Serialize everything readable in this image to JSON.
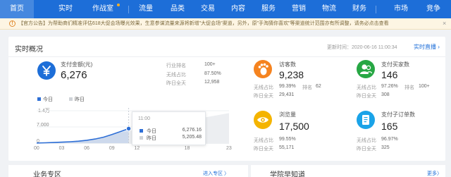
{
  "nav": {
    "items": [
      "首页",
      "实时",
      "作战室",
      "流量",
      "品类",
      "交易",
      "内容",
      "服务",
      "营销",
      "物流",
      "财务",
      "市场",
      "竞争"
    ],
    "active_index": 0,
    "badge_item": "作战室"
  },
  "notice": {
    "icon": "warning-icon",
    "text": "【官方公告】为帮助商们精准评估618大促会场曝光效果，生意参谋流量来源将新增\"大促会场\"渠道，另外，原\"手淘猜你喜欢\"等渠道统计范围亦有所调整，请务必点击查看",
    "close": "×"
  },
  "realtime": {
    "title": "实时概况",
    "update_time": "更新时间：2020-06-16 11:00:34",
    "monitor_link": "实时直播 ›",
    "pay": {
      "icon": "yuan-icon",
      "label": "支付金额(元)",
      "value": "6,276",
      "stats": [
        {
          "key": "行业排名",
          "value": "100+"
        },
        {
          "key": "无线占比",
          "value": "87.50%"
        },
        {
          "key": "昨日全天",
          "value": "12,958"
        }
      ]
    },
    "metrics": [
      {
        "icon": "footprint-icon",
        "color": "#f5831f",
        "label": "访客数",
        "value": "9,238",
        "stats": [
          {
            "key": "无线占比",
            "value": "99.39%"
          },
          {
            "key": "排名",
            "value": "62"
          },
          {
            "key": "昨日全天",
            "value": "29,431"
          }
        ]
      },
      {
        "icon": "buyer-icon",
        "color": "#27a744",
        "label": "支付买家数",
        "value": "146",
        "stats": [
          {
            "key": "无线占比",
            "value": "97.26%"
          },
          {
            "key": "排名",
            "value": "100+"
          },
          {
            "key": "昨日全天",
            "value": "308"
          }
        ]
      },
      {
        "icon": "eye-icon",
        "color": "#f4b400",
        "label": "浏览量",
        "value": "17,500",
        "stats": [
          {
            "key": "无线占比",
            "value": "99.55%"
          },
          {
            "key": "昨日全天",
            "value": "55,171"
          }
        ]
      },
      {
        "icon": "order-icon",
        "color": "#1aa3e8",
        "label": "支付子订单数",
        "value": "165",
        "stats": [
          {
            "key": "无线占比",
            "value": "96.97%"
          },
          {
            "key": "昨日全天",
            "value": "325"
          }
        ]
      }
    ]
  },
  "chart_data": {
    "type": "area",
    "x": [
      "00",
      "01",
      "02",
      "03",
      "04",
      "05",
      "06",
      "07",
      "08",
      "09",
      "10",
      "11"
    ],
    "x_ticks": [
      "00",
      "03",
      "06",
      "09",
      "12",
      "18",
      "23"
    ],
    "y_ticks": [
      "1.4万",
      "7,000",
      "0"
    ],
    "ylim": [
      0,
      14000
    ],
    "series": [
      {
        "name": "今日",
        "color": "#2e6fd6",
        "values": [
          60,
          150,
          260,
          420,
          600,
          860,
          1250,
          1800,
          2600,
          3700,
          5000,
          6276.16
        ]
      },
      {
        "name": "昨日",
        "color": "#cfd3d8",
        "values": [
          70,
          170,
          290,
          440,
          620,
          880,
          1300,
          1850,
          2700,
          3800,
          4600,
          5205.48
        ]
      }
    ],
    "yesterday_full_day_end": 12958,
    "tooltip": {
      "time": "11:00",
      "rows": [
        {
          "name": "今日",
          "value": "6,276.16"
        },
        {
          "name": "昨日",
          "value": "5,205.48"
        }
      ]
    }
  },
  "bottom": {
    "business": {
      "title": "业务专区",
      "link": "进入专区 〉"
    },
    "learn": {
      "title": "学院早知道",
      "link": "更多〉"
    }
  }
}
